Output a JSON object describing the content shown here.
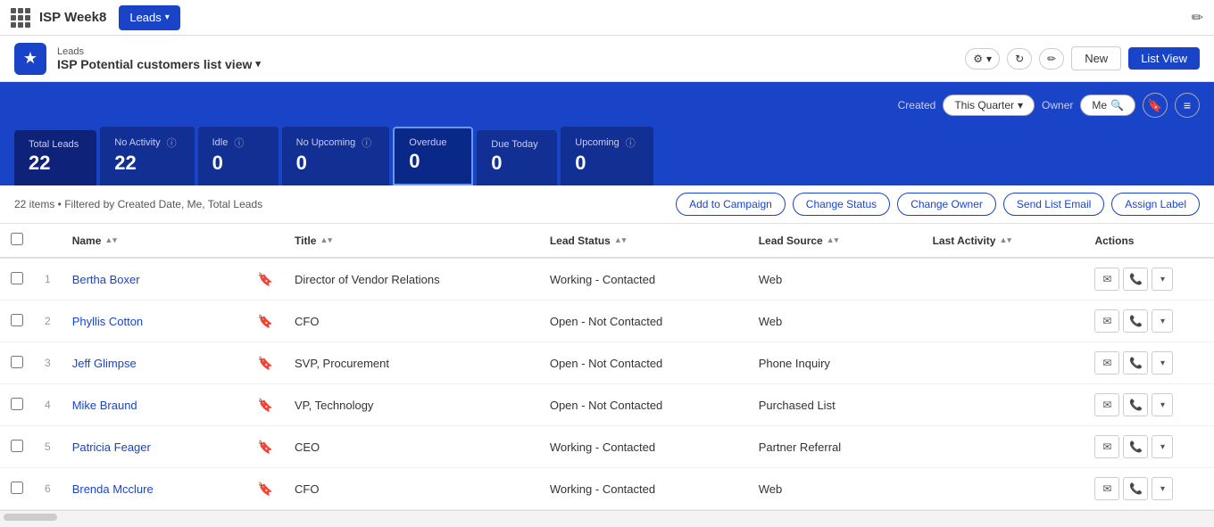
{
  "app": {
    "name": "ISP Week8",
    "grid_icon_label": "app-grid"
  },
  "nav": {
    "tab_label": "Leads",
    "tab_arrow": "▾",
    "edit_icon": "✏"
  },
  "header": {
    "breadcrumb": "Leads",
    "title": "ISP Potential customers list view",
    "title_arrow": "▾",
    "buttons": {
      "settings": "⚙",
      "settings_arrow": "▾",
      "refresh": "↻",
      "edit": "✏",
      "new": "New",
      "list_view": "List View"
    }
  },
  "stats_filters": {
    "created_label": "Created",
    "this_quarter": "This Quarter",
    "this_quarter_arrow": "▾",
    "owner_label": "Owner",
    "me": "Me",
    "search_icon": "🔍",
    "bookmark_icon": "🔖",
    "list_icon": "≡"
  },
  "stats": [
    {
      "label": "Total Leads",
      "value": "22",
      "info": false
    },
    {
      "label": "No Activity",
      "value": "22",
      "info": true
    },
    {
      "label": "Idle",
      "value": "0",
      "info": true
    },
    {
      "label": "No Upcoming",
      "value": "0",
      "info": true
    },
    {
      "label": "Overdue",
      "value": "0",
      "info": false,
      "active": true
    },
    {
      "label": "Due Today",
      "value": "0",
      "info": false
    },
    {
      "label": "Upcoming",
      "value": "0",
      "info": true
    }
  ],
  "toolbar": {
    "filter_info": "22 items • Filtered by Created Date, Me, Total Leads",
    "add_campaign": "Add to Campaign",
    "change_status": "Change Status",
    "change_owner": "Change Owner",
    "send_email": "Send List Email",
    "assign_label": "Assign Label"
  },
  "table": {
    "columns": [
      {
        "id": "name",
        "label": "Name",
        "sortable": true
      },
      {
        "id": "bookmark",
        "label": "",
        "sortable": false
      },
      {
        "id": "title",
        "label": "Title",
        "sortable": true
      },
      {
        "id": "lead_status",
        "label": "Lead Status",
        "sortable": true
      },
      {
        "id": "lead_source",
        "label": "Lead Source",
        "sortable": true
      },
      {
        "id": "last_activity",
        "label": "Last Activity",
        "sortable": true
      },
      {
        "id": "actions",
        "label": "Actions",
        "sortable": false
      }
    ],
    "rows": [
      {
        "num": "1",
        "name": "Bertha Boxer",
        "title": "Director of Vendor Relations",
        "lead_status": "Working - Contacted",
        "lead_source": "Web",
        "last_activity": ""
      },
      {
        "num": "2",
        "name": "Phyllis Cotton",
        "title": "CFO",
        "lead_status": "Open - Not Contacted",
        "lead_source": "Web",
        "last_activity": ""
      },
      {
        "num": "3",
        "name": "Jeff Glimpse",
        "title": "SVP, Procurement",
        "lead_status": "Open - Not Contacted",
        "lead_source": "Phone Inquiry",
        "last_activity": ""
      },
      {
        "num": "4",
        "name": "Mike Braund",
        "title": "VP, Technology",
        "lead_status": "Open - Not Contacted",
        "lead_source": "Purchased List",
        "last_activity": ""
      },
      {
        "num": "5",
        "name": "Patricia Feager",
        "title": "CEO",
        "lead_status": "Working - Contacted",
        "lead_source": "Partner Referral",
        "last_activity": ""
      },
      {
        "num": "6",
        "name": "Brenda Mcclure",
        "title": "CFO",
        "lead_status": "Working - Contacted",
        "lead_source": "Web",
        "last_activity": ""
      }
    ],
    "actions": {
      "email_icon": "✉",
      "phone_icon": "📞",
      "dropdown_icon": "▾"
    }
  }
}
